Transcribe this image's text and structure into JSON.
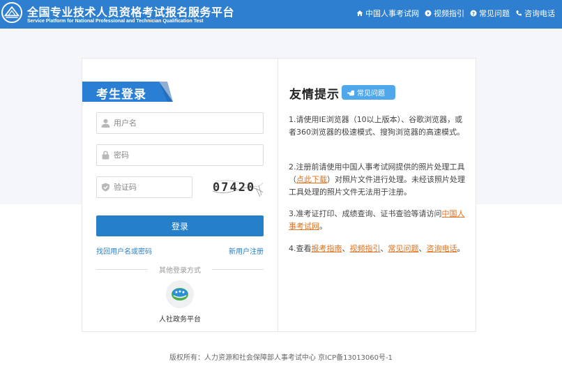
{
  "header": {
    "title": "全国专业技术人员资格考试报名服务平台",
    "subtitle": "Service Platform for National Professional and Technician Qualification Test",
    "nav": [
      {
        "label": "中国人事考试网",
        "icon": "home-icon"
      },
      {
        "label": "视频指引",
        "icon": "play-icon"
      },
      {
        "label": "常见问题",
        "icon": "question-icon"
      },
      {
        "label": "咨询电话",
        "icon": "phone-icon"
      }
    ]
  },
  "login": {
    "title": "考生登录",
    "username_placeholder": "用户名",
    "password_placeholder": "密码",
    "captcha_placeholder": "验证码",
    "captcha_text": "07420",
    "submit_label": "登录",
    "forgot_label": "找回用户名或密码",
    "register_label": "新用户注册",
    "other_methods_label": "其他登录方式",
    "gov_platform_label": "人社政务平台"
  },
  "tips": {
    "title": "友情提示",
    "faq_badge": "常见问题",
    "items": [
      {
        "text": "1.请使用IE浏览器（10以上版本）、谷歌浏览器，或者360浏览器的极速模式、搜狗浏览器的高速模式。"
      },
      {
        "prefix": "2.注册前请使用中国人事考试网提供的照片处理工具（",
        "link": "点此下载",
        "suffix": "）对照片文件进行处理。未经该照片处理工具处理的照片文件无法用于注册。"
      },
      {
        "prefix": "3.准考证打印、成绩查询、证书查验等请访问",
        "link": "中国人事考试网",
        "suffix": "。"
      },
      {
        "prefix": "4.查看",
        "links": [
          "报考指南",
          "视频指引",
          "常见问题",
          "咨询电话"
        ],
        "separator": "、",
        "suffix": "。"
      }
    ]
  },
  "footer": {
    "text": "版权所有：人力资源和社会保障部人事考试中心 京ICP备13013060号-1"
  },
  "colors": {
    "header_bg": "#2e7fd0",
    "button": "#2680c9",
    "link_orange": "#e0701c",
    "banner_blue": "#2a7fd4"
  }
}
